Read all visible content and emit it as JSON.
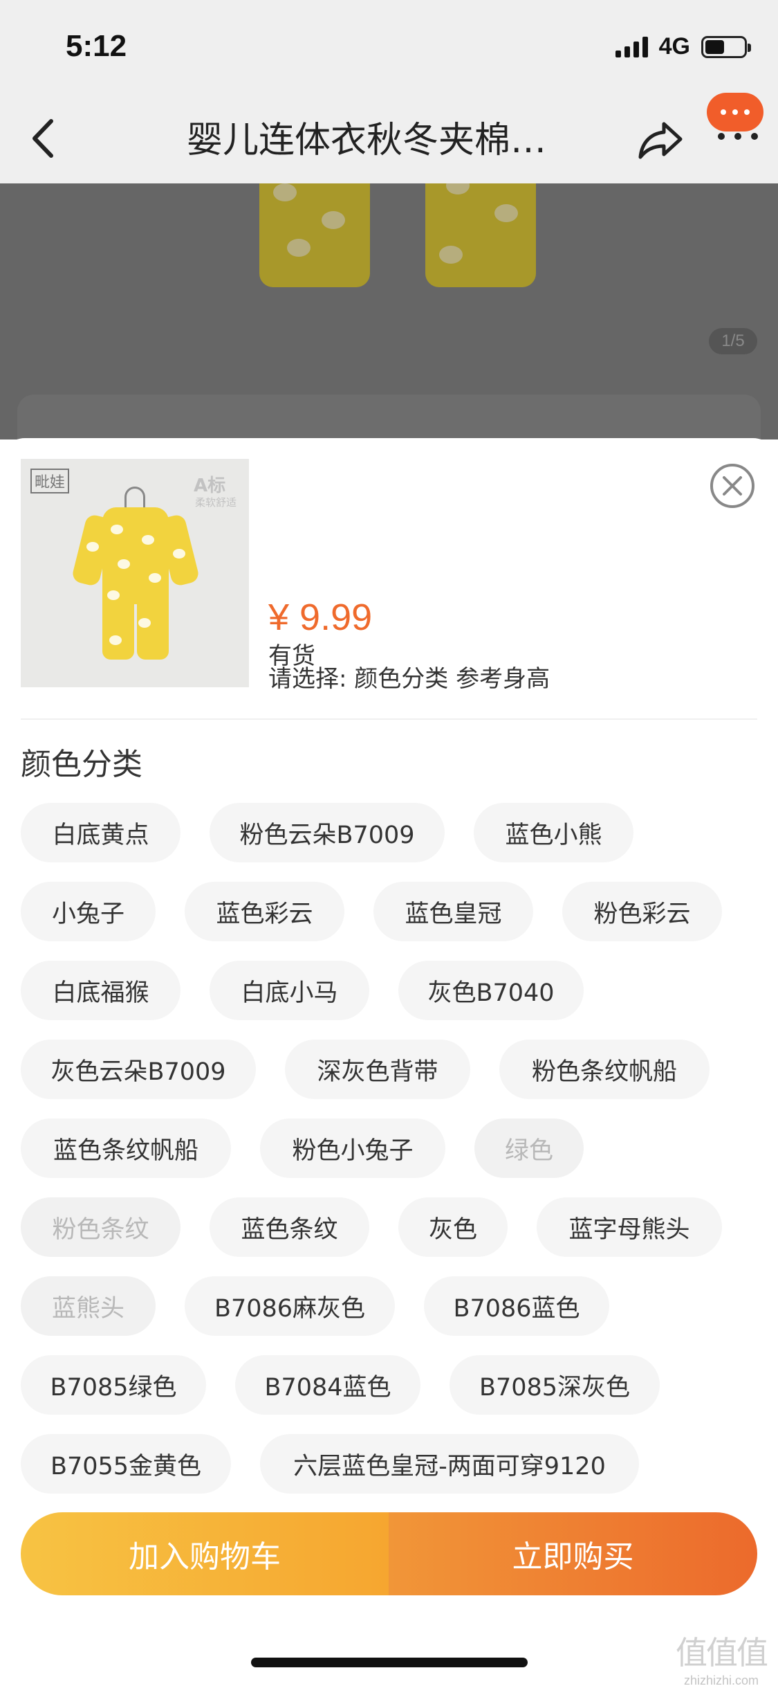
{
  "status": {
    "time": "5:12",
    "network": "4G"
  },
  "nav": {
    "title": "婴儿连体衣秋冬夹棉…"
  },
  "gallery": {
    "pager": "1/5"
  },
  "product": {
    "thumb_logo": "毗娃",
    "thumb_badge": "A标",
    "thumb_badge_sub": "柔软舒适",
    "price": "¥ 9.99",
    "stock": "有货",
    "select_hint": "请选择: 颜色分类 参考身高"
  },
  "color_section": {
    "title": "颜色分类",
    "options": [
      {
        "label": "白底黄点",
        "available": true
      },
      {
        "label": "粉色云朵B7009",
        "available": true
      },
      {
        "label": "蓝色小熊",
        "available": true
      },
      {
        "label": "小兔子",
        "available": true
      },
      {
        "label": "蓝色彩云",
        "available": true
      },
      {
        "label": "蓝色皇冠",
        "available": true
      },
      {
        "label": "粉色彩云",
        "available": true
      },
      {
        "label": "白底福猴",
        "available": true
      },
      {
        "label": "白底小马",
        "available": true
      },
      {
        "label": "灰色B7040",
        "available": true
      },
      {
        "label": "灰色云朵B7009",
        "available": true
      },
      {
        "label": "深灰色背带",
        "available": true
      },
      {
        "label": "粉色条纹帆船",
        "available": true
      },
      {
        "label": "蓝色条纹帆船",
        "available": true
      },
      {
        "label": "粉色小兔子",
        "available": true
      },
      {
        "label": "绿色",
        "available": false
      },
      {
        "label": "粉色条纹",
        "available": false
      },
      {
        "label": "蓝色条纹",
        "available": true
      },
      {
        "label": "灰色",
        "available": true
      },
      {
        "label": "蓝字母熊头",
        "available": true
      },
      {
        "label": "蓝熊头",
        "available": false
      },
      {
        "label": "B7086麻灰色",
        "available": true
      },
      {
        "label": "B7086蓝色",
        "available": true
      },
      {
        "label": "B7085绿色",
        "available": true
      },
      {
        "label": "B7084蓝色",
        "available": true
      },
      {
        "label": "B7085深灰色",
        "available": true
      },
      {
        "label": "B7055金黄色",
        "available": true
      },
      {
        "label": "六层蓝色皇冠-两面可穿9120",
        "available": true
      }
    ]
  },
  "actions": {
    "add_to_cart": "加入购物车",
    "buy_now": "立即购买"
  },
  "watermark": {
    "logo": "值值值",
    "text": "zhizhizhi.com"
  },
  "colors": {
    "accent": "#ef6a2c",
    "cart_start": "#f7c343",
    "buy_end": "#ec6a2c",
    "chip_bg": "#f5f5f5",
    "disabled_text": "#b8b8b8"
  }
}
